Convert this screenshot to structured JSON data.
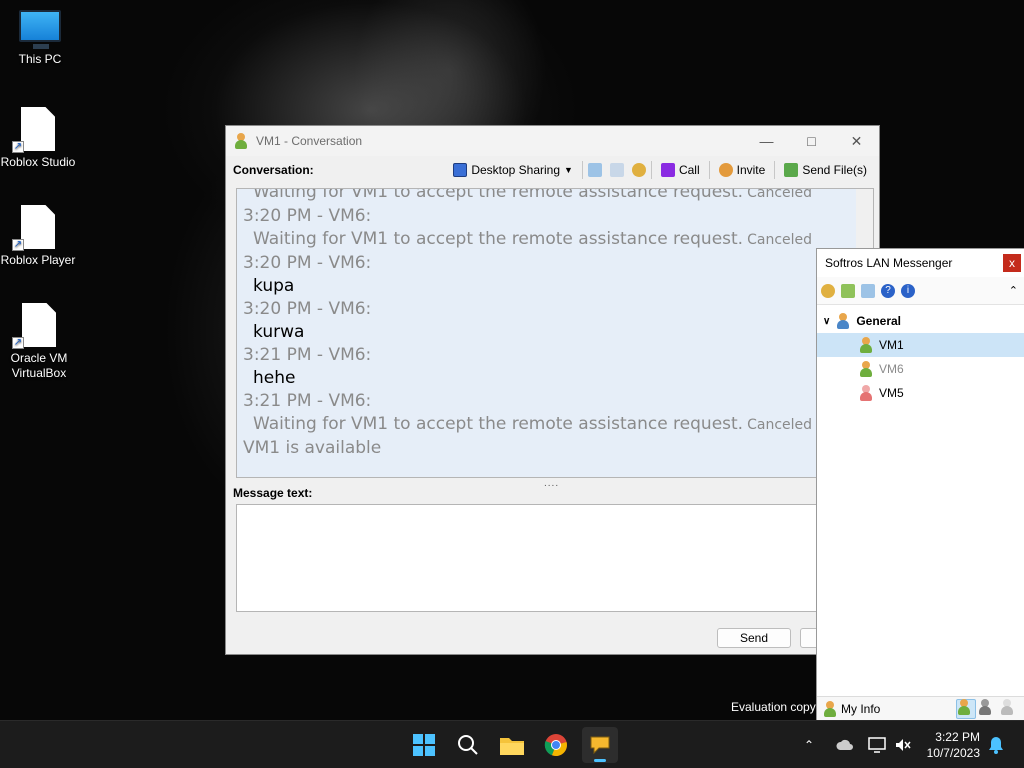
{
  "desktop": {
    "icons": [
      {
        "label": "This PC",
        "icon": "monitor-icon"
      },
      {
        "label": "Roblox Studio",
        "icon": "file-icon"
      },
      {
        "label": "Roblox Player",
        "icon": "file-icon"
      },
      {
        "label": "Oracle VM VirtualBox",
        "icon": "file-icon"
      }
    ],
    "evaluation_text": "Evaluation copy"
  },
  "conversation_window": {
    "title": "VM1 - Conversation",
    "conversation_label": "Conversation:",
    "toolbar": {
      "desktop_sharing": "Desktop Sharing",
      "call": "Call",
      "invite": "Invite",
      "send_files": "Send File(s)"
    },
    "history": {
      "top_partial": {
        "text": "Waiting for VM1 to accept the remote assistance request.",
        "tag": "Canceled"
      },
      "messages": [
        {
          "header": "3:20 PM - VM6:",
          "text": "Waiting for VM1 to accept the remote assistance request.",
          "tag": "Canceled",
          "system": true
        },
        {
          "header": "3:20 PM - VM6:",
          "text": "kupa",
          "tag": "",
          "system": false
        },
        {
          "header": "3:20 PM - VM6:",
          "text": "kurwa",
          "tag": "",
          "system": false
        },
        {
          "header": "3:21 PM - VM6:",
          "text": "hehe",
          "tag": "",
          "system": false
        },
        {
          "header": "3:21 PM - VM6:",
          "text": "Waiting for VM1 to accept the remote assistance request.",
          "tag": "Canceled",
          "system": true
        }
      ],
      "status": "VM1 is available"
    },
    "message_label": "Message text:",
    "message_value": "",
    "send_label": "Send"
  },
  "softros": {
    "title": "Softros LAN Messenger",
    "close": "x",
    "group": "General",
    "contacts": [
      {
        "name": "VM1",
        "status": "online",
        "selected": true
      },
      {
        "name": "VM6",
        "status": "away",
        "selected": false
      },
      {
        "name": "VM5",
        "status": "offline",
        "selected": false
      }
    ],
    "my_info": "My Info"
  },
  "taskbar": {
    "time": "3:22 PM",
    "date": "10/7/2023"
  },
  "colors": {
    "accent": "#4cc2ff",
    "selection": "#cce4f7",
    "history_bg": "#e6eef8",
    "close_red": "#c42b1c"
  }
}
